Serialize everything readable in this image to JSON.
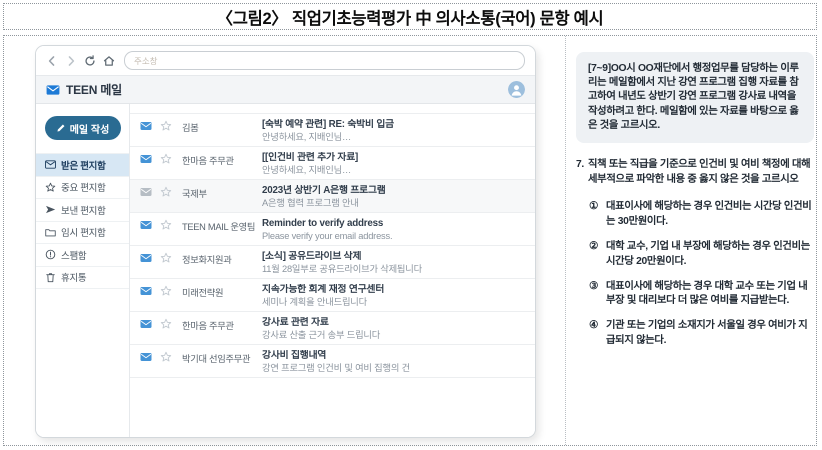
{
  "figure": {
    "title": "〈그림2〉 직업기초능력평가 中 의사소통(국어) 문항 예시"
  },
  "browser": {
    "address_placeholder": "주소창",
    "nav_icons": [
      "chevron-left-icon",
      "chevron-right-icon",
      "refresh-icon",
      "home-icon"
    ]
  },
  "mail": {
    "app_title": "TEEN 메일",
    "app_icon": "envelope-icon",
    "user_icon": "user-avatar-icon",
    "compose_label": "메일 작성",
    "compose_icon": "pencil-icon",
    "sidebar": [
      {
        "label": "받은 편지함",
        "icon": "inbox-icon",
        "selected": true
      },
      {
        "label": "중요 편지함",
        "icon": "star-icon",
        "selected": false
      },
      {
        "label": "보낸 편지함",
        "icon": "send-icon",
        "selected": false
      },
      {
        "label": "임시 편지함",
        "icon": "folder-icon",
        "selected": false
      },
      {
        "label": "스팸함",
        "icon": "spam-icon",
        "selected": false
      },
      {
        "label": "휴지통",
        "icon": "trash-icon",
        "selected": false
      }
    ],
    "emails": [
      {
        "sender": "김봄",
        "subject": "[숙박 예약 관련] RE: 숙박비 입금",
        "preview": "안녕하세요, 지배인님…",
        "state": "unread"
      },
      {
        "sender": "한마음 주무관",
        "subject": "[[인건비 관련 추가 자료]",
        "preview": "안녕하세요, 지배인님…",
        "state": "unread"
      },
      {
        "sender": "국제부",
        "subject": "2023년 상반기 A은행 프로그램",
        "preview": "A은행 협력 프로그램 안내",
        "state": "read"
      },
      {
        "sender": "TEEN MAIL 운영팀",
        "subject": "Reminder to verify address",
        "preview": "Please verify your email address.",
        "state": "unread"
      },
      {
        "sender": "정보화지원과",
        "subject": "[소식] 공유드라이브 삭제",
        "preview": "11월 28일부로 공유드라이브가 삭제됩니다",
        "state": "unread"
      },
      {
        "sender": "미래전략원",
        "subject": "지속가능한 회계 재정 연구센터",
        "preview": "세미나 계획을 안내드립니다",
        "state": "unread"
      },
      {
        "sender": "한마음 주무관",
        "subject": "강사료 관련 자료",
        "preview": "강사료 산출 근거 송부 드립니다",
        "state": "unread"
      },
      {
        "sender": "박기대 선임주무관",
        "subject": "강사비 집행내역",
        "preview": "강연 프로그램 인건비 및 여비 집행의 건",
        "state": "unread"
      }
    ]
  },
  "question_panel": {
    "passage": "[7~9]OO시 OO재단에서 행정업무를 담당하는 이루리는 메일함에서 지난 강연 프로그램 집행 자료를 참고하여 내년도 상반기 강연 프로그램 강사료 내역을 작성하려고 한다. 메일함에 있는 자료를 바탕으로 옳은 것을 고르시오.",
    "question_number": "7.",
    "question_text": "직책 또는 직급을 기준으로 인건비 및 여비 책정에 대해 세부적으로 파악한 내용 중 옳지 않은 것을 고르시오",
    "options": [
      {
        "num": "①",
        "text": "대표이사에 해당하는 경우 인건비는 시간당 인건비는 30만원이다."
      },
      {
        "num": "②",
        "text": "대학 교수, 기업 내 부장에 해당하는 경우 인건비는 시간당 20만원이다."
      },
      {
        "num": "③",
        "text": "대표이사에 해당하는 경우 대학 교수 또는 기업 내 부장 및 대리보다 더 많은 여비를 지급받는다."
      },
      {
        "num": "④",
        "text": "기관 또는 기업의 소재지가 서울일 경우 여비가 지급되지 않는다."
      }
    ]
  },
  "colors": {
    "accent_button": "#2a6b92",
    "selected_sidebar_bg": "#d7e7f4",
    "unread_envelope": "#4493d6",
    "read_envelope": "#b6bdc4",
    "header_envelope": "#1d7ad6",
    "avatar_bg": "#9dbfdd",
    "passage_box_bg": "#eef1f4",
    "subject_text": "#323e4c",
    "preview_text": "#8b949e"
  }
}
